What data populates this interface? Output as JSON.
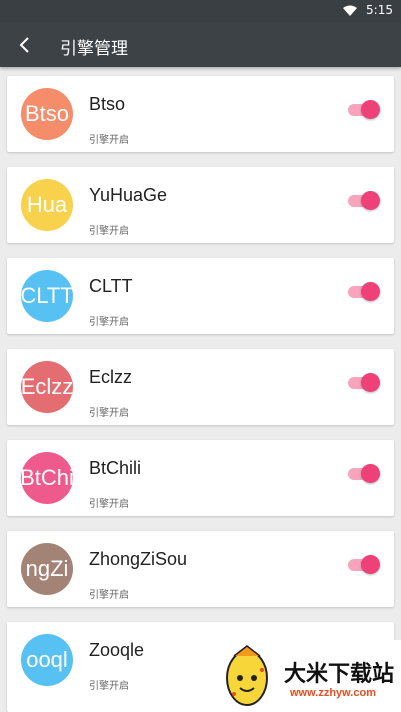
{
  "status_bar": {
    "time": "5:15"
  },
  "app_bar": {
    "title": "引擎管理",
    "back_icon": "back-arrow-icon"
  },
  "colors": {
    "accent": "#ee4178",
    "app_bar": "#3d4247"
  },
  "engines": [
    {
      "name": "Btso",
      "avatar_text": "Btso",
      "avatar_color": "#f58c6a",
      "status": "引擎开启",
      "enabled": true
    },
    {
      "name": "YuHuaGe",
      "avatar_text": "Hua",
      "avatar_color": "#f9d24d",
      "status": "引擎开启",
      "enabled": true
    },
    {
      "name": "CLTT",
      "avatar_text": "CLTT",
      "avatar_color": "#56c1f2",
      "status": "引擎开启",
      "enabled": true
    },
    {
      "name": "Eclzz",
      "avatar_text": "Eclzz",
      "avatar_color": "#e36d71",
      "status": "引擎开启",
      "enabled": true
    },
    {
      "name": "BtChili",
      "avatar_text": "BtChi",
      "avatar_color": "#ef5a8d",
      "status": "引擎开启",
      "enabled": true
    },
    {
      "name": "ZhongZiSou",
      "avatar_text": "ngZi",
      "avatar_color": "#a38376",
      "status": "引擎开启",
      "enabled": true
    },
    {
      "name": "Zooqle",
      "avatar_text": "ooql",
      "avatar_color": "#56c1f2",
      "status": "引擎开启",
      "enabled": true
    }
  ],
  "watermark": {
    "title": "大米下载站",
    "url": "www.zzhyw.com"
  }
}
